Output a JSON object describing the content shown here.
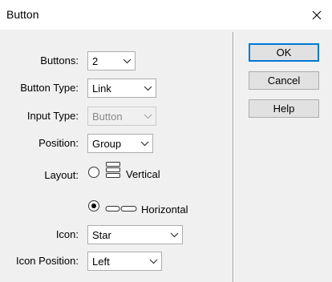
{
  "window": {
    "title": "Button"
  },
  "form": {
    "buttons": {
      "label": "Buttons:",
      "value": "2"
    },
    "button_type": {
      "label": "Button Type:",
      "value": "Link"
    },
    "input_type": {
      "label": "Input Type:",
      "value": "Button",
      "disabled": true
    },
    "position": {
      "label": "Position:",
      "value": "Group"
    },
    "layout": {
      "label": "Layout:",
      "options": [
        {
          "label": "Vertical",
          "selected": false,
          "icon": "vertical-layout-icon"
        },
        {
          "label": "Horizontal",
          "selected": true,
          "icon": "horizontal-layout-icon"
        }
      ]
    },
    "icon": {
      "label": "Icon:",
      "value": "Star"
    },
    "icon_position": {
      "label": "Icon Position:",
      "value": "Left"
    }
  },
  "actions": {
    "ok": "OK",
    "cancel": "Cancel",
    "help": "Help"
  },
  "colors": {
    "titlebar": "#ffffff",
    "dialog_bg": "#f0f0f0",
    "default_button_border": "#0078d7"
  },
  "icons": {
    "close": "close-icon",
    "chevron": "chevron-down-icon"
  }
}
